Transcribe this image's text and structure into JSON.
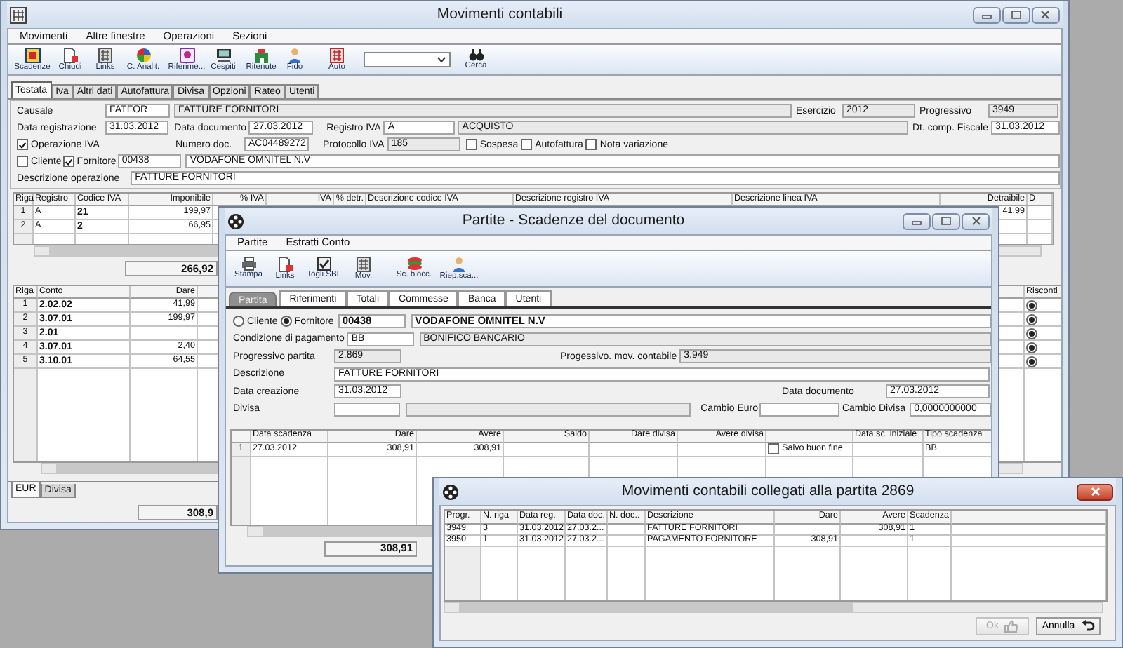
{
  "main_window": {
    "title": "Movimenti contabili",
    "menu": [
      "Movimenti",
      "Altre finestre",
      "Operazioni",
      "Sezioni"
    ],
    "toolbar": [
      "Scadenze",
      "Chiudi",
      "Links",
      "C. Analit.",
      "Riferime...",
      "Cespiti",
      "Ritenute",
      "Fido",
      "Auto"
    ],
    "search_button": "Cerca",
    "tabs": [
      {
        "label": "Testata",
        "selected": true
      },
      {
        "label": "Iva",
        "selected": false
      },
      {
        "label": "Altri dati",
        "selected": false
      },
      {
        "label": "Autofattura",
        "selected": false
      },
      {
        "label": "Divisa",
        "selected": false
      },
      {
        "label": "Opzioni",
        "selected": false
      },
      {
        "label": "Rateo",
        "selected": false
      },
      {
        "label": "Utenti",
        "selected": false
      }
    ],
    "form_rows": [
      [
        {
          "kind": "label",
          "text": "Causale"
        },
        {
          "kind": "field",
          "value": "FATFOR",
          "readonly": false
        },
        {
          "kind": "field",
          "value": "FATTURE FORNITORI",
          "readonly": true
        },
        {
          "kind": "label",
          "text": "Esercizio"
        },
        {
          "kind": "field",
          "value": "2012",
          "readonly": true
        },
        {
          "kind": "label",
          "text": "Progressivo"
        },
        {
          "kind": "field",
          "value": "3949",
          "readonly": true
        }
      ],
      [
        {
          "kind": "label",
          "text": "Data registrazione"
        },
        {
          "kind": "field",
          "value": "31.03.2012",
          "readonly": false
        },
        {
          "kind": "label",
          "text": "Data documento"
        },
        {
          "kind": "field",
          "value": "27.03.2012",
          "readonly": false
        },
        {
          "kind": "label",
          "text": "Registro IVA"
        },
        {
          "kind": "field",
          "value": "A",
          "readonly": false
        },
        {
          "kind": "field",
          "value": "ACQUISTO",
          "readonly": true
        },
        {
          "kind": "label",
          "text": "Dt. comp. Fiscale"
        },
        {
          "kind": "field",
          "value": "31.03.2012",
          "readonly": false
        }
      ],
      [
        {
          "kind": "check",
          "label": "Operazione IVA",
          "checked": true
        },
        {
          "kind": "label",
          "text": "Numero doc."
        },
        {
          "kind": "field",
          "value": "AC04489272",
          "readonly": false
        },
        {
          "kind": "label",
          "text": "Protocollo IVA"
        },
        {
          "kind": "field",
          "value": "185",
          "readonly": true
        },
        {
          "kind": "check",
          "label": "Sospesa",
          "checked": false
        },
        {
          "kind": "check",
          "label": "Autofattura",
          "checked": false
        },
        {
          "kind": "check",
          "label": "Nota variazione",
          "checked": false
        }
      ],
      [
        {
          "kind": "check",
          "label": "Cliente",
          "checked": false
        },
        {
          "kind": "check",
          "label": "Fornitore",
          "checked": true
        },
        {
          "kind": "field",
          "value": "00438",
          "readonly": false
        },
        {
          "kind": "field",
          "value": "VODAFONE OMNITEL N.V",
          "readonly": false
        }
      ],
      [
        {
          "kind": "label",
          "text": "Descrizione operazione"
        },
        {
          "kind": "field",
          "value": "FATTURE FORNITORI",
          "readonly": false
        }
      ]
    ],
    "iva_table": {
      "columns": [
        "Riga",
        "Registro",
        "Codice IVA",
        "Imponibile",
        "% IVA",
        "IVA",
        "% detr.",
        "Descrizione codice IVA",
        "Descrizione registro IVA",
        "Descrizione linea IVA",
        "Detraibile",
        "D"
      ],
      "rows": [
        {
          "riga": "1",
          "registro": "A",
          "codice_iva": "21",
          "imponibile": "199,97",
          "detraibile": "41,99"
        },
        {
          "riga": "2",
          "registro": "A",
          "codice_iva": "2",
          "imponibile": "66,95"
        }
      ]
    },
    "iva_total": "266,92",
    "accounts_table": {
      "columns": [
        "Riga",
        "Conto",
        "Dare",
        "Risconti"
      ],
      "rows": [
        {
          "riga": "1",
          "conto": "2.02.02",
          "dare": "41,99",
          "risconto": true
        },
        {
          "riga": "2",
          "conto": "3.07.01",
          "dare": "199,97",
          "risconto": true
        },
        {
          "riga": "3",
          "conto": "2.01",
          "risconto": true
        },
        {
          "riga": "4",
          "conto": "3.07.01",
          "dare": "2,40",
          "risconto": true
        },
        {
          "riga": "5",
          "conto": "3.10.01",
          "dare": "64,55",
          "risconto": true
        }
      ]
    },
    "currency_tabs": [
      {
        "label": "EUR",
        "selected": true
      },
      {
        "label": "Divisa",
        "selected": false
      }
    ],
    "accounts_total": "308,9"
  },
  "partite_window": {
    "title": "Partite - Scadenze del documento",
    "menu": [
      "Partite",
      "Estratti Conto"
    ],
    "toolbar": [
      "Stampa",
      "Links",
      "Togli SBF",
      "Mov.",
      "Sc. blocc.",
      "Riep.sca..."
    ],
    "tabs": [
      {
        "label": "Partita",
        "selected": true
      },
      {
        "label": "Riferimenti",
        "selected": false
      },
      {
        "label": "Totali",
        "selected": false
      },
      {
        "label": "Commesse",
        "selected": false
      },
      {
        "label": "Banca",
        "selected": false
      },
      {
        "label": "Utenti",
        "selected": false
      }
    ],
    "form_rows": [
      [
        {
          "kind": "radio",
          "label": "Cliente",
          "selected": false
        },
        {
          "kind": "radio",
          "label": "Fornitore",
          "selected": true
        },
        {
          "kind": "field",
          "value": "00438",
          "readonly": false
        },
        {
          "kind": "field",
          "value": "VODAFONE OMNITEL N.V",
          "readonly": false
        }
      ],
      [
        {
          "kind": "label",
          "text": "Condizione di pagamento"
        },
        {
          "kind": "field",
          "value": "BB",
          "readonly": false
        },
        {
          "kind": "field",
          "value": "BONIFICO BANCARIO",
          "readonly": true
        }
      ],
      [
        {
          "kind": "label",
          "text": "Progressivo partita"
        },
        {
          "kind": "field",
          "value": "2.869",
          "readonly": true
        },
        {
          "kind": "label",
          "text": "Progessivo. mov. contabile"
        },
        {
          "kind": "field",
          "value": "3.949",
          "readonly": true
        }
      ],
      [
        {
          "kind": "label",
          "text": "Descrizione"
        },
        {
          "kind": "field",
          "value": "FATTURE FORNITORI",
          "readonly": false
        }
      ],
      [
        {
          "kind": "label",
          "text": "Data creazione"
        },
        {
          "kind": "field",
          "value": "31.03.2012",
          "readonly": false
        },
        {
          "kind": "label",
          "text": "Data documento"
        },
        {
          "kind": "field",
          "value": "27.03.2012",
          "readonly": false
        }
      ],
      [
        {
          "kind": "label",
          "text": "Divisa"
        },
        {
          "kind": "field",
          "readonly": false
        },
        {
          "kind": "field",
          "readonly": true
        },
        {
          "kind": "label",
          "text": "Cambio Euro"
        },
        {
          "kind": "field",
          "readonly": false
        },
        {
          "kind": "label",
          "text": "Cambio Divisa"
        },
        {
          "kind": "field",
          "value": "0,0000000000",
          "readonly": false
        }
      ]
    ],
    "schedule_table": {
      "columns": [
        "Data scadenza",
        "Dare",
        "Avere",
        "Saldo",
        "Dare divisa",
        "Avere divisa",
        "Data sc. iniziale",
        "Tipo scadenza"
      ],
      "rows": [
        {
          "riga": "1",
          "data_scadenza": "27.03.2012",
          "dare": "308,91",
          "avere": "308,91",
          "salvo_buon_fine": {
            "label": "Salvo buon fine",
            "checked": false
          },
          "tipo_scadenza": "BB"
        }
      ]
    },
    "total": "308,91"
  },
  "linked_window": {
    "title": "Movimenti contabili collegati alla partita 2869",
    "columns": [
      "Progr.",
      "N. riga",
      "Data reg.",
      "Data doc.",
      "N. doc..",
      "Descrizione",
      "Dare",
      "Avere",
      "Scadenza"
    ],
    "rows": [
      {
        "progr": "3949",
        "n_riga": "3",
        "data_reg": "31.03.2012",
        "data_doc": "27.03.2...",
        "descrizione": "FATTURE FORNITORI",
        "avere": "308,91",
        "scadenza": "1"
      },
      {
        "progr": "3950",
        "n_riga": "1",
        "data_reg": "31.03.2012",
        "data_doc": "27.03.2...",
        "descrizione": "PAGAMENTO FORNITORE",
        "dare": "308,91",
        "scadenza": "1"
      }
    ],
    "buttons": [
      {
        "label": "Ok",
        "disabled": true
      },
      {
        "label": "Annulla",
        "disabled": false
      }
    ]
  }
}
